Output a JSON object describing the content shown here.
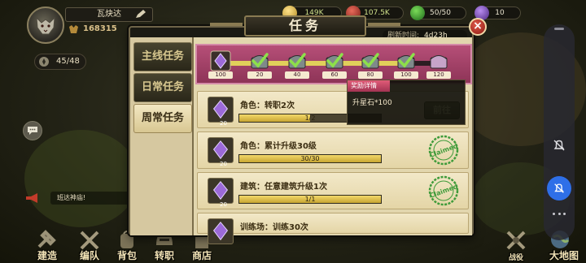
{
  "player": {
    "name": "瓦炔达",
    "power": "168315",
    "energy": "45/48"
  },
  "resources": {
    "coins": "149K",
    "food": "107.5K",
    "stamina": "50/50",
    "gems": "10"
  },
  "dialog": {
    "title": "任务",
    "refresh_label": "刷新时间:",
    "refresh_time": "4d23h",
    "close_label": "×"
  },
  "tabs": [
    {
      "label": "主线任务"
    },
    {
      "label": "日常任务"
    },
    {
      "label": "周常任务"
    }
  ],
  "milestones": [
    {
      "value": "100",
      "claimed": false,
      "type": "gem"
    },
    {
      "value": "20",
      "claimed": true,
      "type": "chest"
    },
    {
      "value": "40",
      "claimed": true,
      "type": "chest"
    },
    {
      "value": "60",
      "claimed": true,
      "type": "chest"
    },
    {
      "value": "80",
      "claimed": true,
      "type": "chest"
    },
    {
      "value": "100",
      "claimed": true,
      "type": "chest"
    },
    {
      "value": "120",
      "claimed": false,
      "type": "chest"
    }
  ],
  "milestone_progress": 0.86,
  "tooltip": {
    "header": "奖励详情",
    "body": "升星石*100"
  },
  "quests": [
    {
      "title": "角色：转职2次",
      "progress_text": "1/2",
      "progress": 0.5,
      "reward": "20",
      "action": "前往",
      "claimed_label": ""
    },
    {
      "title": "角色：累计升级30级",
      "progress_text": "30/30",
      "progress": 1.0,
      "reward": "20",
      "action": "",
      "claimed_label": "Claimed"
    },
    {
      "title": "建筑：任意建筑升级1次",
      "progress_text": "1/1",
      "progress": 1.0,
      "reward": "20",
      "action": "",
      "claimed_label": "Claimed"
    },
    {
      "title": "训练场：训练30次",
      "progress_text": "",
      "progress": 0,
      "reward": "",
      "action": "",
      "claimed_label": ""
    }
  ],
  "broadcast": "班达神庙!",
  "bottom_nav": [
    {
      "label": "建造"
    },
    {
      "label": "编队"
    },
    {
      "label": "背包"
    },
    {
      "label": "转职"
    },
    {
      "label": "商店"
    },
    {
      "label": "战役"
    },
    {
      "label": "大地图"
    }
  ],
  "colors": {
    "accent_pink": "#b64f78",
    "progress_yellow": "#e1cf5a",
    "claimed_green": "#3f9b3a",
    "close_red": "#c43a2c",
    "fab_blue": "#2e6fe8"
  }
}
